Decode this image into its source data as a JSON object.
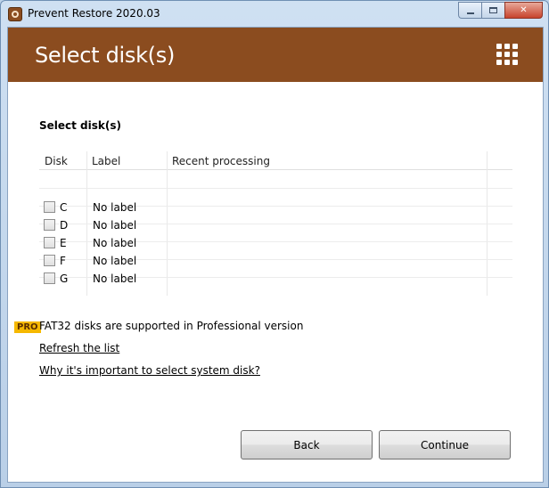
{
  "window": {
    "title": "Prevent Restore 2020.03",
    "close_glyph": "✕"
  },
  "header": {
    "title": "Select disk(s)",
    "menu_icon": "grid-menu-icon",
    "background_color": "#8b4c1f"
  },
  "section": {
    "title": "Select disk(s)"
  },
  "table": {
    "columns": [
      "Disk",
      "Label",
      "Recent processing"
    ],
    "rows": [
      {
        "disk": "C",
        "label": "No label",
        "recent": "",
        "checked": false
      },
      {
        "disk": "D",
        "label": "No label",
        "recent": "",
        "checked": false
      },
      {
        "disk": "E",
        "label": "No label",
        "recent": "",
        "checked": false
      },
      {
        "disk": "F",
        "label": "No label",
        "recent": "",
        "checked": false
      },
      {
        "disk": "G",
        "label": "No label",
        "recent": "",
        "checked": false
      }
    ]
  },
  "pro": {
    "badge": "PRO",
    "text": "FAT32 disks are supported in Professional version",
    "badge_color": "#f5b800"
  },
  "links": {
    "refresh": "Refresh the list",
    "why_system": "Why it's important to select system disk?"
  },
  "buttons": {
    "back": "Back",
    "continue": "Continue"
  }
}
